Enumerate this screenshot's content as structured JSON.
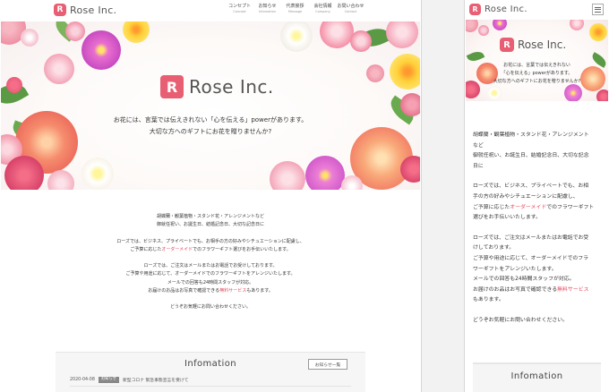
{
  "brand": {
    "name": "Rose Inc.",
    "mark": "R",
    "color": "#e85f73"
  },
  "nav": [
    {
      "jp": "コンセプト",
      "en": "Concept"
    },
    {
      "jp": "お知らせ",
      "en": "Infomation"
    },
    {
      "jp": "代表挨拶",
      "en": "Message"
    },
    {
      "jp": "会社情報",
      "en": "Company"
    },
    {
      "jp": "お問い合わせ",
      "en": "Contact"
    }
  ],
  "hero": {
    "title": "Rose Inc.",
    "line1": "お花には、言葉では伝えきれない「心を伝える」powerがあります。",
    "line2": "大切な方へのギフトにお花を贈りませんか?"
  },
  "body": {
    "p1_l1": "胡蝶蘭・観葉植物・スタンド花・アレンジメントなど",
    "p1_l2": "御就任祝い、お誕生日、結婚記念日、大切な記念日に",
    "p2_l1": "ローズでは、ビジネス、プライベートでも、お相手の方の好みやシチュエーションに配慮し、",
    "p2_l2_pre": "ご予算に応じた",
    "p2_l2_accent": "オーダーメイド",
    "p2_l2_post": "でのフラワーギフト選びをお手伝いいたします。",
    "p3_l1": "ローズでは、ご注文はメールまたはお電話でお受けしております。",
    "p3_l2": "ご予算や用途に応じて、オーダーメイドでのフラワーギフトをアレンジいたします。",
    "p3_l3": "メールでの回答も24時間スタッフが対応。",
    "p3_l4_pre": "お届けのお品はお写真で確認できる",
    "p3_l4_accent": "無料サービス",
    "p3_l4_post": "もあります。",
    "p4": "どうぞお気軽にお問い合わせください。"
  },
  "info": {
    "title": "Infomation",
    "button": "お知らせ一覧",
    "news": [
      {
        "date": "2020-04-08",
        "tag": "お知らせ",
        "title": "新型コロナ 緊急事態宣言を受けて"
      }
    ]
  },
  "mobile": {
    "hero_line1": "お花には、言葉では伝えきれない",
    "hero_line2": "「心を伝える」powerがあります。",
    "hero_line3": "大切な方へのギフトにお花を贈りませんか?",
    "p1_l1": "胡蝶蘭・観葉植物・スタンド花・アレンジメント",
    "p1_l2": "など",
    "p1_l3": "御就任祝い、お誕生日、結婚記念日、大切な記念",
    "p1_l4": "日に",
    "p2_l1": "ローズでは、ビジネス、プライベートでも、お相",
    "p2_l2": "手の方の好みやシチュエーションに配慮し、",
    "p2_l3_pre": "ご予算に応じた",
    "p2_l3_accent": "オーダーメイド",
    "p2_l3_post": "でのフラワーギフト",
    "p2_l4": "選びをお手伝いいたします。",
    "p3_l1": "ローズでは、ご注文はメールまたはお電話でお受",
    "p3_l2": "けしております。",
    "p3_l3": "ご予算や用途に応じて、オーダーメイドでのフラ",
    "p3_l4": "ワーギフトをアレンジいたします。",
    "p3_l5": "メールでの回答も24時間スタッフが対応。",
    "p3_l6_pre": "お届けのお品はお写真で確認できる",
    "p3_l6_accent": "無料サービス",
    "p3_l7": "もあります。",
    "p4": "どうぞお気軽にお問い合わせください。",
    "info_title": "Infomation"
  }
}
